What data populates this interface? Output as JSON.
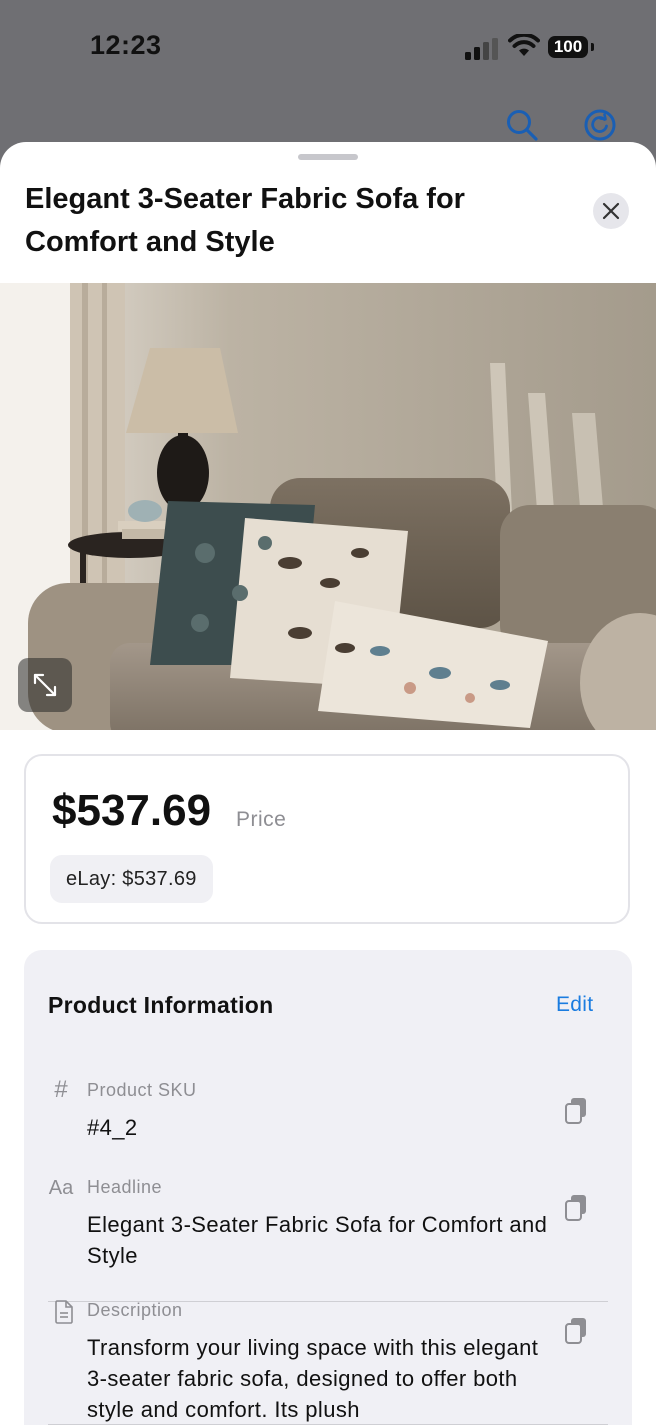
{
  "status_bar": {
    "time": "12:23",
    "battery": "100"
  },
  "sheet": {
    "title": "Elegant 3-Seater Fabric Sofa for Comfort and Style"
  },
  "price": {
    "amount": "$537.69",
    "label": "Price",
    "marketplace_chip": "eLay: $537.69"
  },
  "product_info": {
    "title": "Product Information",
    "edit_label": "Edit",
    "rows": [
      {
        "icon": "#",
        "label": "Product SKU",
        "value": "#4_2"
      },
      {
        "icon": "Aa",
        "label": "Headline",
        "value": "Elegant 3-Seater Fabric Sofa for Comfort and Style"
      },
      {
        "icon": "document-icon",
        "label": "Description",
        "value": "Transform your living space with this elegant 3-seater fabric sofa, designed to offer both style and comfort. Its plush"
      }
    ]
  },
  "colors": {
    "accent": "#1a7ce0",
    "card_bg": "#f0f0f5"
  }
}
